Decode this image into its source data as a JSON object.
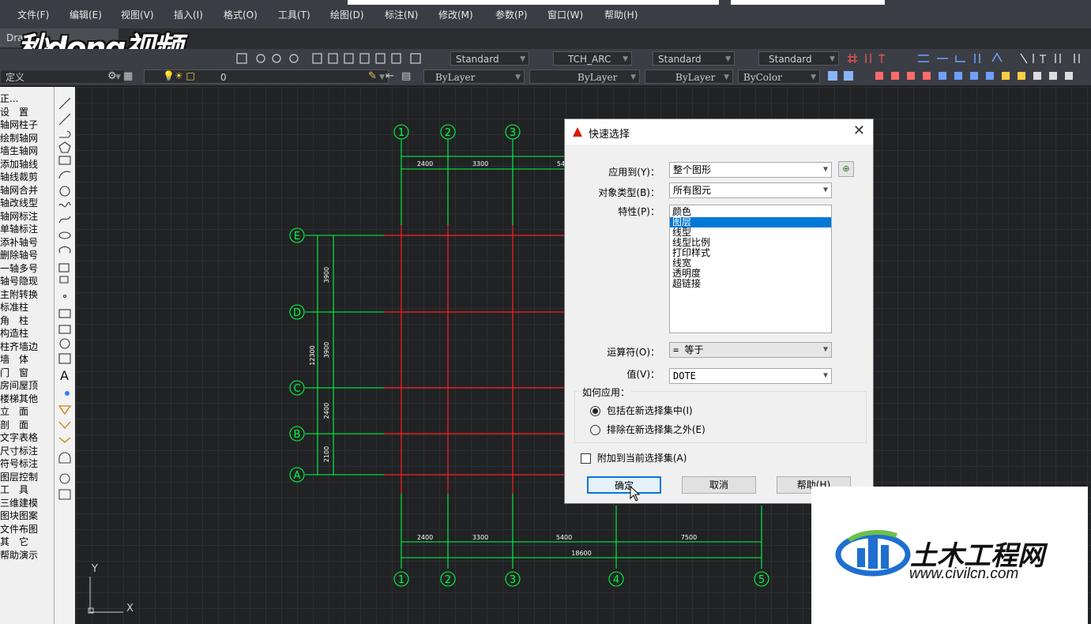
{
  "menu": [
    "文件(F)",
    "编辑(E)",
    "视图(V)",
    "插入(I)",
    "格式(O)",
    "工具(T)",
    "绘图(D)",
    "标注(N)",
    "修改(M)",
    "参数(P)",
    "窗口(W)",
    "帮助(H)"
  ],
  "tab_label": "Drav",
  "video_logo": "秒dong视频",
  "toolbar": {
    "text_style": "Standard",
    "dim_style": "TCH_ARC",
    "table_style": "Standard",
    "multileader_style": "Standard",
    "layer_state": "定义",
    "layer_name": "0",
    "color": "ByLayer",
    "linetype": "ByLayer",
    "lineweight": "ByLayer",
    "plotstyle": "ByColor"
  },
  "tianzheng_menu": [
    "正...",
    "设　置",
    "轴网柱子",
    "绘制轴网",
    "墙生轴网",
    "添加轴线",
    "轴线裁剪",
    "轴网合并",
    "轴改线型",
    "轴网标注",
    "单轴标注",
    "添补轴号",
    "删除轴号",
    "一轴多号",
    "轴号隐现",
    "主附转换",
    "标准柱",
    "角　柱",
    "构造柱",
    "柱齐墙边",
    "墙　体",
    "门　窗",
    "房间屋顶",
    "楼梯其他",
    "立　面",
    "剖　面",
    "文字表格",
    "尺寸标注",
    "符号标注",
    "图层控制",
    "工　具",
    "三维建模",
    "图块图案",
    "文件布图",
    "其　它",
    "帮助演示"
  ],
  "drawing": {
    "col_labels": [
      "1",
      "2",
      "3",
      "4",
      "5"
    ],
    "row_labels": [
      "E",
      "D",
      "C",
      "B",
      "A"
    ],
    "top_dims": [
      "2400",
      "3300",
      "54"
    ],
    "bottom_dims": [
      "2400",
      "3300",
      "5400",
      "7500"
    ],
    "bottom_total": "18600",
    "left_dims": [
      "3900",
      "3900",
      "2400",
      "2100"
    ],
    "left_total": "12300",
    "ucs_y": "Y",
    "ucs_x": "X"
  },
  "dialog": {
    "title": "快速选择",
    "apply_to_label": "应用到(Y)：",
    "apply_to_value": "整个图形",
    "object_type_label": "对象类型(B)：",
    "object_type_value": "所有图元",
    "properties_label": "特性(P)：",
    "properties": [
      "颜色",
      "图层",
      "线型",
      "线型比例",
      "打印样式",
      "线宽",
      "透明度",
      "超链接"
    ],
    "selected_property": "图层",
    "operator_label": "运算符(O)：",
    "operator_value": "= 等于",
    "value_label": "值(V)：",
    "value_value": "DOTE",
    "how_to_apply_label": "如何应用：",
    "include_label": "包括在新选择集中(I)",
    "exclude_label": "排除在新选择集之外(E)",
    "append_label": "附加到当前选择集(A)",
    "ok_label": "确定",
    "cancel_label": "取消",
    "help_label": "帮助(H)"
  },
  "watermark": {
    "name": "土木工程网",
    "url": "www.civilcn.com"
  },
  "colors": {
    "axis_green": "#00ff40",
    "axis_red": "#ff2020",
    "dialog_highlight": "#0078d7"
  }
}
